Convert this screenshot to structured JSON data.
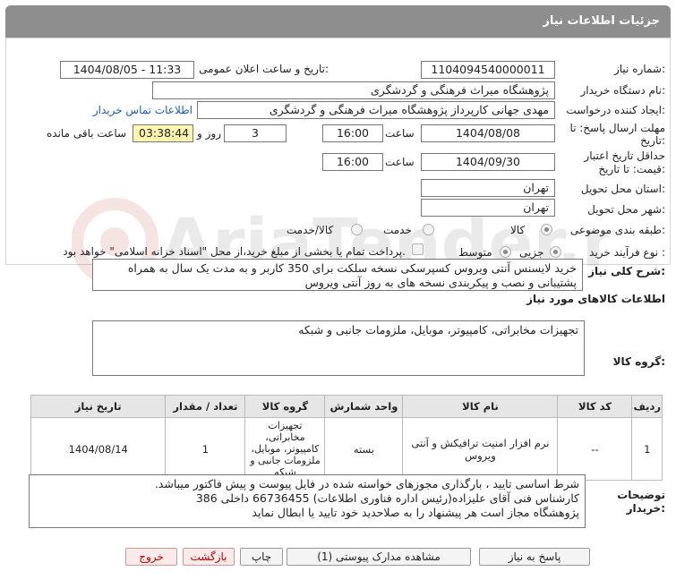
{
  "header": {
    "title": "جزئیات اطلاعات نیاز"
  },
  "fields": {
    "need_number_label": "شماره نیاز:",
    "need_number": "1104094540000011",
    "announce_label": "تاریخ و ساعت اعلان عمومی:",
    "announce_value": "1404/08/05 - 11:33",
    "buyer_label": "نام دستگاه خریدار:",
    "buyer_value": "پژوهشگاه میراث فرهنگی و گردشگری",
    "creator_label": "ایجاد کننده درخواست:",
    "creator_value": "مهدی جهانی کارپرداز پژوهشگاه میراث فرهنگی و گردشگری",
    "contact_link": "اطلاعات تماس خریدار",
    "deadline_label_1": "مهلت ارسال پاسخ: تا",
    "deadline_label_2": "تاریخ:",
    "deadline_date": "1404/08/08",
    "time_label": "ساعت",
    "deadline_time": "16:00",
    "days_value": "3",
    "days_label": "روز و",
    "remaining_value": "03:38:44",
    "remaining_label": "ساعت باقی مانده",
    "validity_label_1": "حداقل تاریخ اعتبار",
    "validity_label_2": "قیمت: تا تاریخ:",
    "validity_date": "1404/09/30",
    "validity_time": "16:00",
    "province_label": "استان محل تحویل:",
    "province_value": "تهران",
    "city_label": "شهر محل تحویل:",
    "city_value": "تهران",
    "category_label": "طبقه بندی موضوعی:",
    "category_options": [
      "کالا",
      "خدمت",
      "کالا/خدمت"
    ],
    "category_selected": "کالا",
    "process_label": "نوع فرآیند خرید :",
    "process_options": [
      "جزیی",
      "متوسط"
    ],
    "process_selected": "جزیی",
    "payment_note": "پرداخت تمام یا بخشی از مبلغ خرید،از محل \"اسناد خزانه اسلامی\" خواهد بود."
  },
  "description": {
    "label": "شرح کلی نیاز:",
    "value": "خرید لایسنس آنتی ویروس کسپرسکی نسخه سلکت برای 350 کاربر و به مدت یک سال به همراه پشتیبانی و نصب و پیکربندی نسخه های به روز آنتی ویروس"
  },
  "goods": {
    "section_title": "اطلاعات کالاهای مورد نیاز",
    "group_label": "گروه کالا:",
    "group_value": "تجهیزات مخابراتی، کامپیوتر، موبایل، ملزومات جانبی و شبکه"
  },
  "table": {
    "headers": [
      "ردیف",
      "کد کالا",
      "نام کالا",
      "واحد شمارش",
      "گروه کالا",
      "تعداد / مقدار",
      "تاریخ نیاز"
    ],
    "rows": [
      [
        "1",
        "--",
        "نرم افزار امنیت ترافیکش و آنتی ویروس",
        "بسته",
        "تجهیزات مخابراتی، کامپیوتر، موبایل، ملزومات جانبی و شبکه",
        "1",
        "1404/08/14"
      ]
    ]
  },
  "buyer_notes": {
    "label_1": "توضیحات",
    "label_2": "خریدار:",
    "lines": [
      "شرط اساسی تایید ، بارگذاری مجوزهای خواسته شده در فایل پیوست و پیش فاکتور میباشد.",
      "کارشناس فنی آقای علیزاده(رئیس اداره فناوری اطلاعات) 66736455 داخلی 386",
      "پژوهشگاه مجاز است هر پیشنهاد را به صلاحدید خود تایید یا ابطال نماید"
    ]
  },
  "buttons": {
    "reply": "پاسخ به نیاز",
    "attachments": "مشاهده مدارک پیوستی (1)",
    "print": "چاپ",
    "back": "بازگشت",
    "exit": "خروج"
  },
  "watermark": {
    "text": "AriaTender.neT"
  },
  "colors": {
    "header": "#8e8e8e",
    "remaining_bg": "#fff6b0",
    "link": "#1a5fb4"
  }
}
